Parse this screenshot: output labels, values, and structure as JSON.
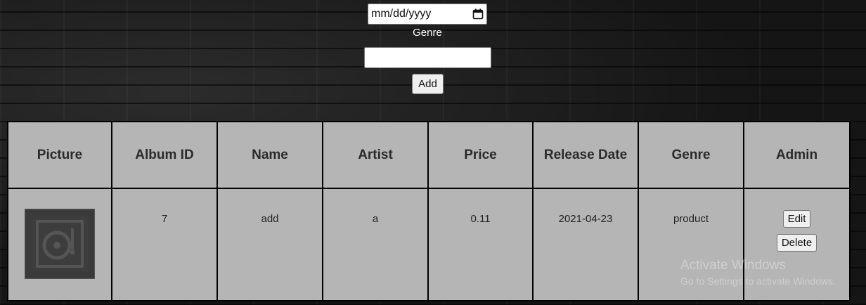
{
  "form": {
    "date_placeholder": "mm/dd/yyyy",
    "genre_label": "Genre",
    "genre_value": "",
    "add_label": "Add"
  },
  "table": {
    "headers": [
      "Picture",
      "Album ID",
      "Name",
      "Artist",
      "Price",
      "Release Date",
      "Genre",
      "Admin"
    ],
    "rows": [
      {
        "picture_icon": "album-placeholder-icon",
        "album_id": "7",
        "name": "add",
        "artist": "a",
        "price": "0.11",
        "release_date": "2021-04-23",
        "genre": "product",
        "edit_label": "Edit",
        "delete_label": "Delete"
      }
    ]
  },
  "watermark": {
    "title": "Activate Windows",
    "subtitle": "Go to Settings to activate Windows."
  },
  "colors": {
    "table_background": "#b5b5b5",
    "page_background": "#141414"
  }
}
